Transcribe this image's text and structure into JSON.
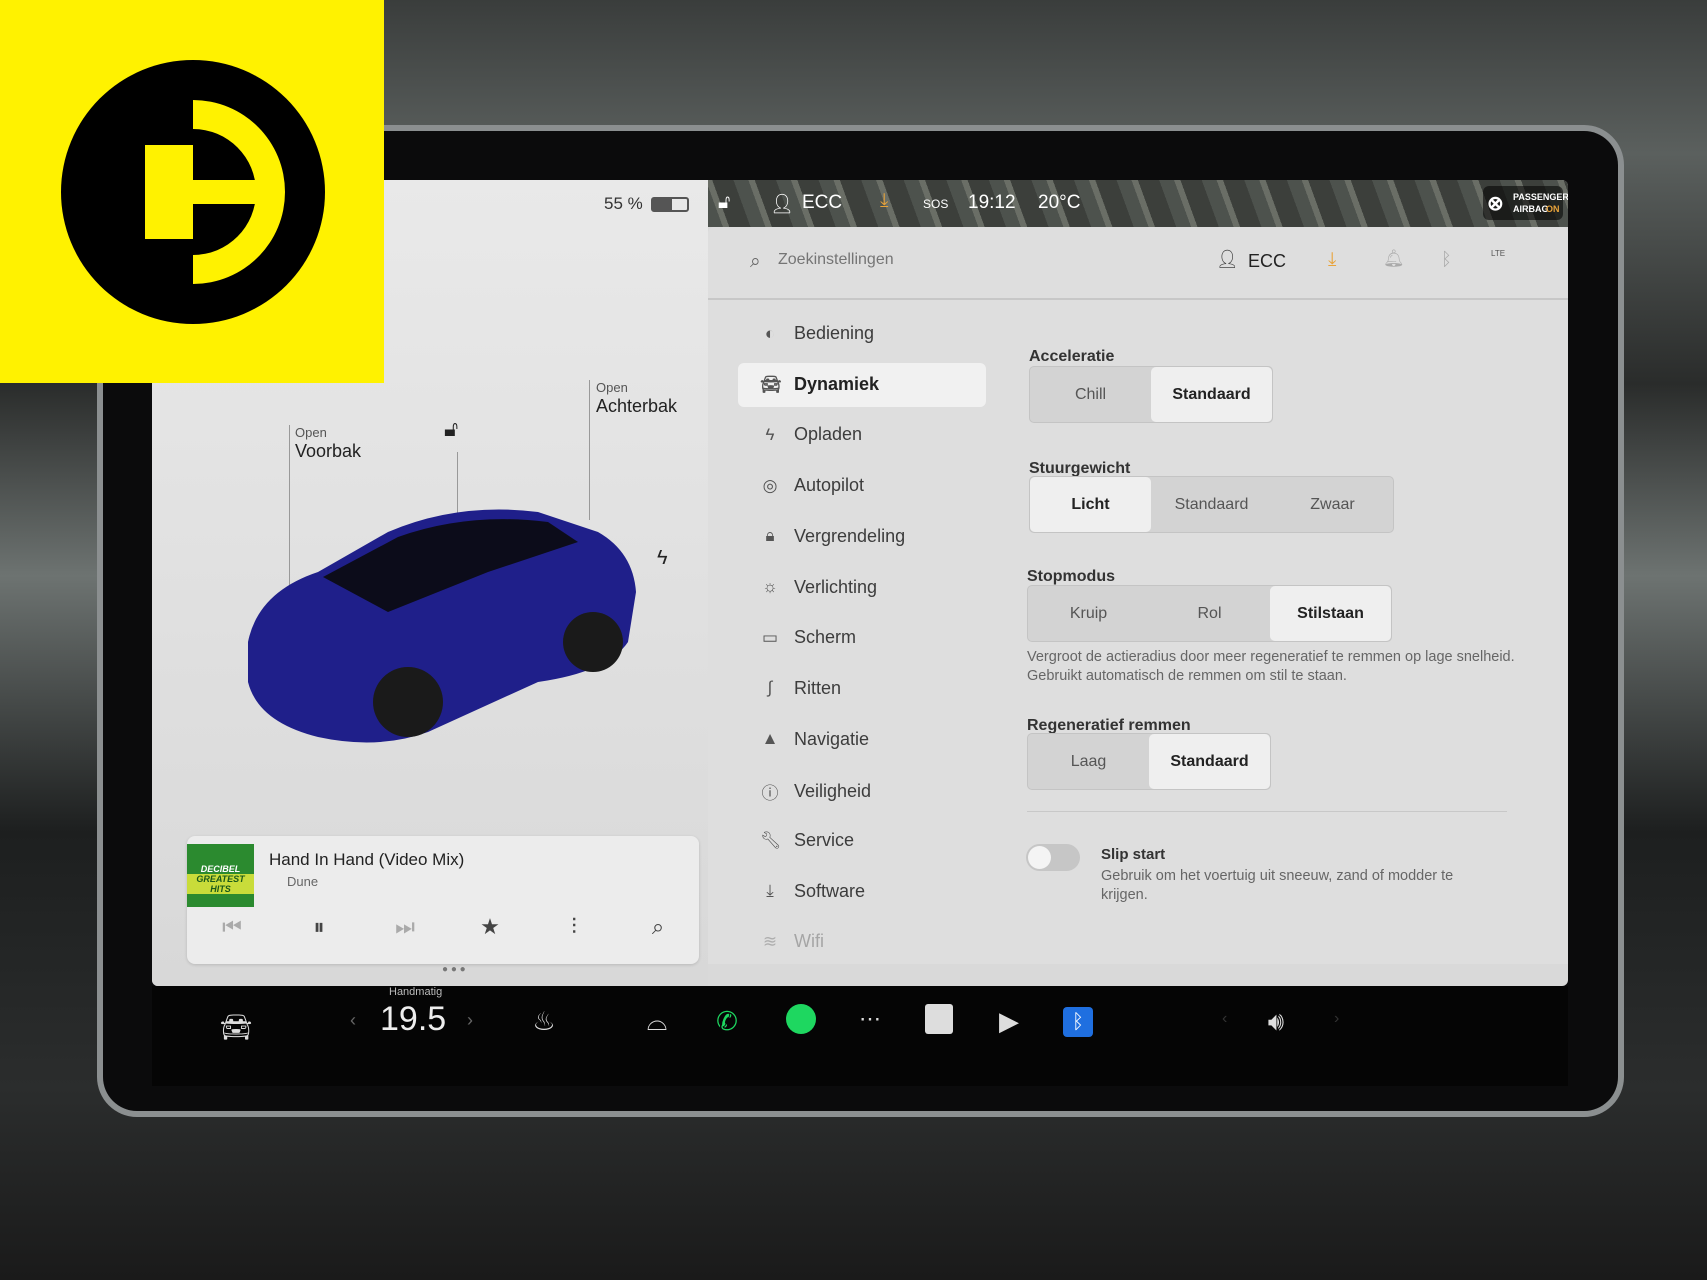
{
  "status_bar": {
    "profile": "ECC",
    "sos": "SOS",
    "time": "19:12",
    "temperature": "20°C",
    "airbag_line1": "PASSENGER",
    "airbag_line2": "AIRBAG",
    "airbag_state": "ON"
  },
  "car_panel": {
    "battery": "55 %",
    "battery_level": 0.55,
    "frunk_state": "Open",
    "frunk_label": "Voorbak",
    "trunk_state": "Open",
    "trunk_label": "Achterbak",
    "car_color": "#1f1f8a"
  },
  "media": {
    "title": "Hand In Hand (Video Mix)",
    "source": "Dune",
    "album_art_line1": "DECIBEL",
    "album_art_line2": "GREATEST HITS"
  },
  "settings": {
    "search_placeholder": "Zoekinstellingen",
    "profile": "ECC",
    "signal": "LTE",
    "menu": [
      {
        "label": "Bediening",
        "icon": "toggle-icon"
      },
      {
        "label": "Dynamiek",
        "icon": "car-icon",
        "active": true
      },
      {
        "label": "Opladen",
        "icon": "bolt-icon"
      },
      {
        "label": "Autopilot",
        "icon": "steering-wheel-icon"
      },
      {
        "label": "Vergrendeling",
        "icon": "lock-icon"
      },
      {
        "label": "Verlichting",
        "icon": "light-icon"
      },
      {
        "label": "Scherm",
        "icon": "display-icon"
      },
      {
        "label": "Ritten",
        "icon": "trips-icon"
      },
      {
        "label": "Navigatie",
        "icon": "navigation-icon"
      },
      {
        "label": "Veiligheid",
        "icon": "safety-icon"
      },
      {
        "label": "Service",
        "icon": "wrench-icon"
      },
      {
        "label": "Software",
        "icon": "download-icon"
      },
      {
        "label": "Wifi",
        "icon": "wifi-icon"
      }
    ],
    "acceleratie": {
      "label": "Acceleratie",
      "options": [
        "Chill",
        "Standaard"
      ],
      "selected": "Standaard"
    },
    "stuurgewicht": {
      "label": "Stuurgewicht",
      "options": [
        "Licht",
        "Standaard",
        "Zwaar"
      ],
      "selected": "Licht"
    },
    "stopmodus": {
      "label": "Stopmodus",
      "options": [
        "Kruip",
        "Rol",
        "Stilstaan"
      ],
      "selected": "Stilstaan",
      "description": "Vergroot de actieradius door meer regeneratief te remmen op lage snelheid. Gebruikt automatisch de remmen om stil te staan."
    },
    "regen": {
      "label": "Regeneratief remmen",
      "options": [
        "Laag",
        "Standaard"
      ],
      "selected": "Standaard"
    },
    "slip_start": {
      "label": "Slip start",
      "enabled": false,
      "description": "Gebruik om het voertuig uit sneeuw, zand of modder te krijgen."
    }
  },
  "dock": {
    "climate_mode": "Handmatig",
    "temperature": "19.5"
  },
  "colors": {
    "logo_yellow": "#fff200",
    "accent_orange": "#e8a33a",
    "spotify_green": "#1ed760",
    "bluetooth_blue": "#1f6fe0"
  }
}
